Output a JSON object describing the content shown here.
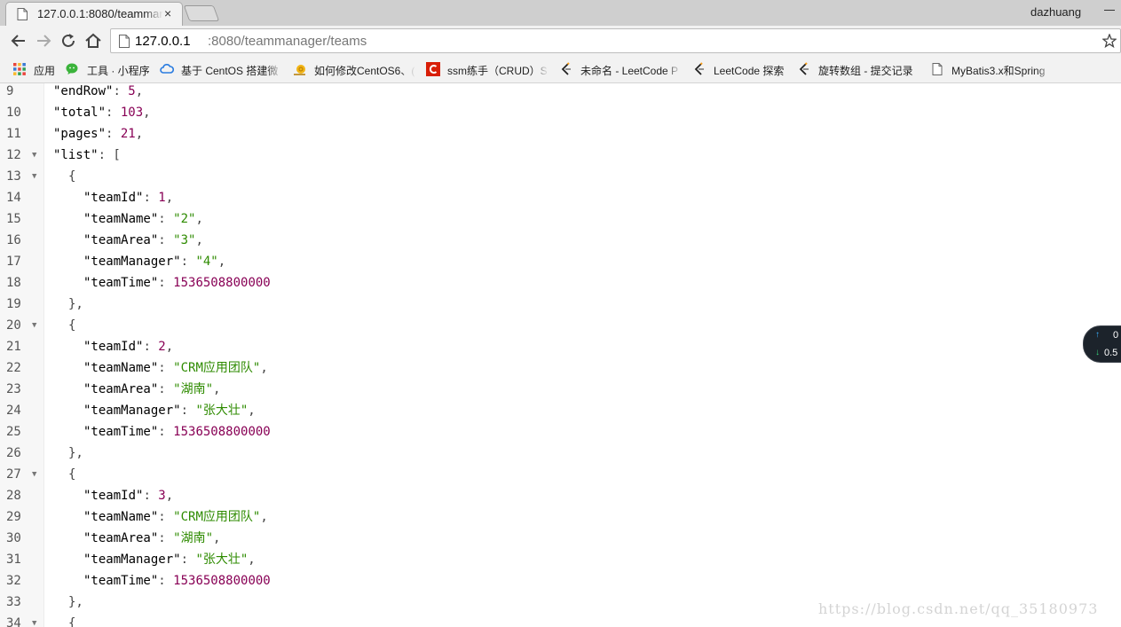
{
  "browser": {
    "tab": {
      "title": "127.0.0.1:8080/teammanager/teams",
      "close_glyph": "×",
      "favicon": "page-icon"
    },
    "user": "dazhuang",
    "url": {
      "host": "127.0.0.1",
      "path": ":8080/teammanager/teams"
    }
  },
  "bookmarks": [
    {
      "label": "应用",
      "icon": "apps-grid-icon"
    },
    {
      "label": "工具 · 小程序",
      "icon": "wechat-icon"
    },
    {
      "label": "基于 CentOS 搭建微",
      "icon": "cloud-icon"
    },
    {
      "label": "如何修改CentOS6、(",
      "icon": "snail-icon"
    },
    {
      "label": "ssm练手（CRUD）S",
      "icon": "csdn-icon"
    },
    {
      "label": "未命名 - LeetCode P",
      "icon": "leetcode-icon"
    },
    {
      "label": "LeetCode 探索",
      "icon": "leetcode-icon"
    },
    {
      "label": "旋转数组 - 提交记录",
      "icon": "leetcode-icon"
    },
    {
      "label": "MyBatis3.x和Spring",
      "icon": "page-icon"
    }
  ],
  "lines": [
    {
      "n": "9",
      "fold": false,
      "indent": 1,
      "tokens": [
        [
          "k",
          "\"endRow\""
        ],
        [
          "p",
          ": "
        ],
        [
          "n",
          "5"
        ],
        [
          "p",
          ","
        ]
      ]
    },
    {
      "n": "10",
      "fold": false,
      "indent": 1,
      "tokens": [
        [
          "k",
          "\"total\""
        ],
        [
          "p",
          ": "
        ],
        [
          "n",
          "103"
        ],
        [
          "p",
          ","
        ]
      ]
    },
    {
      "n": "11",
      "fold": false,
      "indent": 1,
      "tokens": [
        [
          "k",
          "\"pages\""
        ],
        [
          "p",
          ": "
        ],
        [
          "n",
          "21"
        ],
        [
          "p",
          ","
        ]
      ]
    },
    {
      "n": "12",
      "fold": true,
      "indent": 1,
      "tokens": [
        [
          "k",
          "\"list\""
        ],
        [
          "p",
          ": ["
        ]
      ]
    },
    {
      "n": "13",
      "fold": true,
      "indent": 2,
      "tokens": [
        [
          "p",
          "{"
        ]
      ]
    },
    {
      "n": "14",
      "fold": false,
      "indent": 3,
      "tokens": [
        [
          "k",
          "\"teamId\""
        ],
        [
          "p",
          ": "
        ],
        [
          "n",
          "1"
        ],
        [
          "p",
          ","
        ]
      ]
    },
    {
      "n": "15",
      "fold": false,
      "indent": 3,
      "tokens": [
        [
          "k",
          "\"teamName\""
        ],
        [
          "p",
          ": "
        ],
        [
          "s",
          "\"2\""
        ],
        [
          "p",
          ","
        ]
      ]
    },
    {
      "n": "16",
      "fold": false,
      "indent": 3,
      "tokens": [
        [
          "k",
          "\"teamArea\""
        ],
        [
          "p",
          ": "
        ],
        [
          "s",
          "\"3\""
        ],
        [
          "p",
          ","
        ]
      ]
    },
    {
      "n": "17",
      "fold": false,
      "indent": 3,
      "tokens": [
        [
          "k",
          "\"teamManager\""
        ],
        [
          "p",
          ": "
        ],
        [
          "s",
          "\"4\""
        ],
        [
          "p",
          ","
        ]
      ]
    },
    {
      "n": "18",
      "fold": false,
      "indent": 3,
      "tokens": [
        [
          "k",
          "\"teamTime\""
        ],
        [
          "p",
          ": "
        ],
        [
          "n",
          "1536508800000"
        ]
      ]
    },
    {
      "n": "19",
      "fold": false,
      "indent": 2,
      "tokens": [
        [
          "p",
          "},"
        ]
      ]
    },
    {
      "n": "20",
      "fold": true,
      "indent": 2,
      "tokens": [
        [
          "p",
          "{"
        ]
      ]
    },
    {
      "n": "21",
      "fold": false,
      "indent": 3,
      "tokens": [
        [
          "k",
          "\"teamId\""
        ],
        [
          "p",
          ": "
        ],
        [
          "n",
          "2"
        ],
        [
          "p",
          ","
        ]
      ]
    },
    {
      "n": "22",
      "fold": false,
      "indent": 3,
      "tokens": [
        [
          "k",
          "\"teamName\""
        ],
        [
          "p",
          ": "
        ],
        [
          "s",
          "\"CRM应用团队\""
        ],
        [
          "p",
          ","
        ]
      ]
    },
    {
      "n": "23",
      "fold": false,
      "indent": 3,
      "tokens": [
        [
          "k",
          "\"teamArea\""
        ],
        [
          "p",
          ": "
        ],
        [
          "s",
          "\"湖南\""
        ],
        [
          "p",
          ","
        ]
      ]
    },
    {
      "n": "24",
      "fold": false,
      "indent": 3,
      "tokens": [
        [
          "k",
          "\"teamManager\""
        ],
        [
          "p",
          ": "
        ],
        [
          "s",
          "\"张大壮\""
        ],
        [
          "p",
          ","
        ]
      ]
    },
    {
      "n": "25",
      "fold": false,
      "indent": 3,
      "tokens": [
        [
          "k",
          "\"teamTime\""
        ],
        [
          "p",
          ": "
        ],
        [
          "n",
          "1536508800000"
        ]
      ]
    },
    {
      "n": "26",
      "fold": false,
      "indent": 2,
      "tokens": [
        [
          "p",
          "},"
        ]
      ]
    },
    {
      "n": "27",
      "fold": true,
      "indent": 2,
      "tokens": [
        [
          "p",
          "{"
        ]
      ]
    },
    {
      "n": "28",
      "fold": false,
      "indent": 3,
      "tokens": [
        [
          "k",
          "\"teamId\""
        ],
        [
          "p",
          ": "
        ],
        [
          "n",
          "3"
        ],
        [
          "p",
          ","
        ]
      ]
    },
    {
      "n": "29",
      "fold": false,
      "indent": 3,
      "tokens": [
        [
          "k",
          "\"teamName\""
        ],
        [
          "p",
          ": "
        ],
        [
          "s",
          "\"CRM应用团队\""
        ],
        [
          "p",
          ","
        ]
      ]
    },
    {
      "n": "30",
      "fold": false,
      "indent": 3,
      "tokens": [
        [
          "k",
          "\"teamArea\""
        ],
        [
          "p",
          ": "
        ],
        [
          "s",
          "\"湖南\""
        ],
        [
          "p",
          ","
        ]
      ]
    },
    {
      "n": "31",
      "fold": false,
      "indent": 3,
      "tokens": [
        [
          "k",
          "\"teamManager\""
        ],
        [
          "p",
          ": "
        ],
        [
          "s",
          "\"张大壮\""
        ],
        [
          "p",
          ","
        ]
      ]
    },
    {
      "n": "32",
      "fold": false,
      "indent": 3,
      "tokens": [
        [
          "k",
          "\"teamTime\""
        ],
        [
          "p",
          ": "
        ],
        [
          "n",
          "1536508800000"
        ]
      ]
    },
    {
      "n": "33",
      "fold": false,
      "indent": 2,
      "tokens": [
        [
          "p",
          "},"
        ]
      ]
    },
    {
      "n": "34",
      "fold": true,
      "indent": 2,
      "tokens": [
        [
          "p",
          "{"
        ]
      ]
    }
  ],
  "speed_widget": {
    "up": "0",
    "down": "0.5"
  },
  "watermark": "https://blog.csdn.net/qq_35180973",
  "colors": {
    "key": "#000000",
    "number": "#880055",
    "string": "#2e8b00"
  }
}
